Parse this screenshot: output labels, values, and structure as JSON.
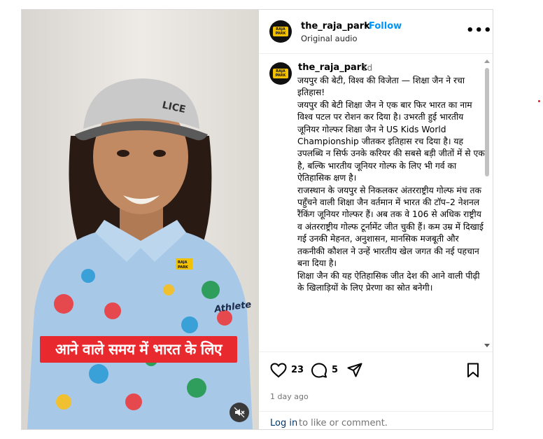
{
  "video": {
    "caption": "आने वाले समय में भारत के लिए",
    "cap_logo_line1": "RAJA",
    "cap_logo_line2": "PARK",
    "shirt_text": "Athlete"
  },
  "header": {
    "username": "the_raja_park",
    "separator": "•",
    "follow_label": "Follow",
    "audio_label": "Original audio",
    "more_label": "•••",
    "avatar_line1": "RAJA",
    "avatar_line2": "PARK"
  },
  "comment": {
    "username": "the_raja_park",
    "time": "1d",
    "avatar_line1": "RAJA",
    "avatar_line2": "PARK",
    "paragraphs": [
      "जयपुर की बेटी, विश्व की विजेता — शिक्षा जैन ने रचा इतिहास!",
      "जयपुर की बेटी शिक्षा जैन ने एक बार फिर भारत का नाम विश्व पटल पर रोशन कर दिया है। उभरती हुई भारतीय जूनियर गोल्फर शिक्षा जैन ने US Kids World Championship जीतकर इतिहास रच दिया है। यह उपलब्धि न सिर्फ उनके करियर की सबसे बड़ी जीतों में से एक है, बल्कि भारतीय जूनियर गोल्फ के लिए भी गर्व का ऐतिहासिक क्षण है।",
      "राजस्थान के जयपुर से निकलकर अंतरराष्ट्रीय गोल्फ मंच तक पहुँचने वाली शिक्षा जैन वर्तमान में भारत की टॉप–2 नेशनल रैंकिंग जूनियर गोल्फर हैं। अब तक वे 106 से अधिक राष्ट्रीय व अंतरराष्ट्रीय गोल्फ टूर्नामेंट जीत चुकी हैं। कम उम्र में दिखाई गई उनकी मेहनत, अनुशासन, मानसिक मजबूती और तकनीकी कौशल ने उन्हें भारतीय खेल जगत की नई पहचान बना दिया है।",
      "शिक्षा जैन की यह ऐतिहासिक जीत देश की आने वाली पीढ़ी के खिलाड़ियों के लिए प्रेरणा का स्रोत बनेगी।"
    ]
  },
  "actions": {
    "like_count": "23",
    "comment_count": "5",
    "posted_ago": "1 day ago",
    "login_link": "Log in",
    "login_rest": "to like or comment."
  },
  "colors": {
    "accent_blue": "#0095f6",
    "caption_red": "#e8292e",
    "link_navy": "#00376b",
    "muted_gray": "#737373"
  }
}
